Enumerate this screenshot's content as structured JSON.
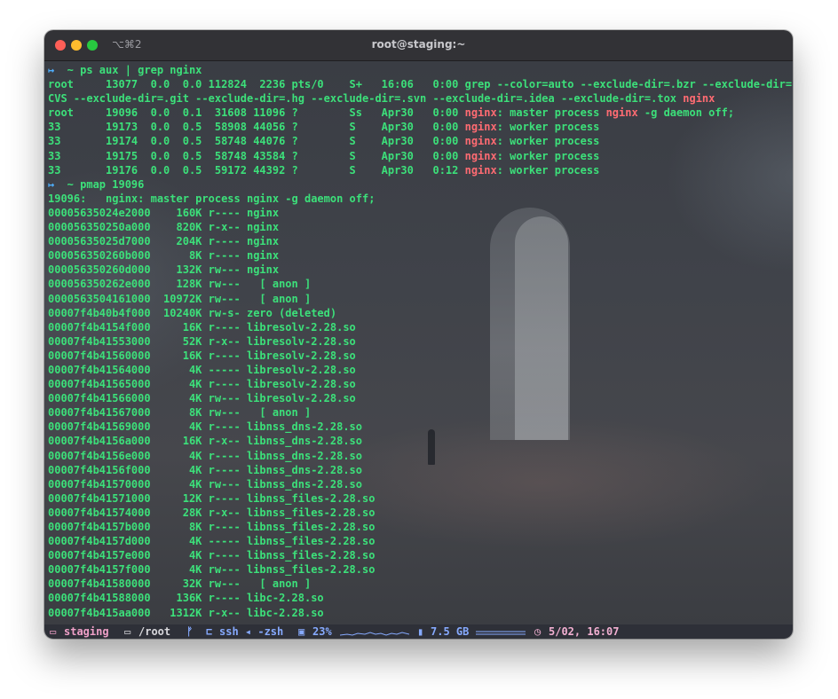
{
  "window": {
    "title": "root@staging:~",
    "tab_shortcut": "⌥⌘2"
  },
  "terminal": {
    "lines": [
      [
        {
          "t": "↦ ",
          "c": "p"
        },
        {
          "t": " ~ ps aux | grep nginx",
          "c": "g"
        }
      ],
      [
        {
          "t": "root     13077  0.0  0.0 112824  2236 pts/0    S+   16:06   0:00 grep --color=auto --exclude-dir=.bzr --exclude-dir=",
          "c": "g"
        }
      ],
      [
        {
          "t": "CVS --exclude-dir=.git --exclude-dir=.hg --exclude-dir=.svn --exclude-dir=.idea --exclude-dir=.tox ",
          "c": "g"
        },
        {
          "t": "nginx",
          "c": "r"
        }
      ],
      [
        {
          "t": "root     19096  0.0  0.1  31608 11096 ?        Ss   Apr30   0:00 ",
          "c": "g"
        },
        {
          "t": "nginx",
          "c": "r"
        },
        {
          "t": ": master process ",
          "c": "g"
        },
        {
          "t": "nginx",
          "c": "r"
        },
        {
          "t": " -g daemon off;",
          "c": "g"
        }
      ],
      [
        {
          "t": "33       19173  0.0  0.5  58908 44056 ?        S    Apr30   0:00 ",
          "c": "g"
        },
        {
          "t": "nginx",
          "c": "r"
        },
        {
          "t": ": worker process",
          "c": "g"
        }
      ],
      [
        {
          "t": "33       19174  0.0  0.5  58748 44076 ?        S    Apr30   0:00 ",
          "c": "g"
        },
        {
          "t": "nginx",
          "c": "r"
        },
        {
          "t": ": worker process",
          "c": "g"
        }
      ],
      [
        {
          "t": "33       19175  0.0  0.5  58748 43584 ?        S    Apr30   0:00 ",
          "c": "g"
        },
        {
          "t": "nginx",
          "c": "r"
        },
        {
          "t": ": worker process",
          "c": "g"
        }
      ],
      [
        {
          "t": "33       19176  0.0  0.5  59172 44392 ?        S    Apr30   0:12 ",
          "c": "g"
        },
        {
          "t": "nginx",
          "c": "r"
        },
        {
          "t": ": worker process",
          "c": "g"
        }
      ],
      [
        {
          "t": "↦ ",
          "c": "p"
        },
        {
          "t": " ~ pmap 19096",
          "c": "g"
        }
      ],
      [
        {
          "t": "19096:   nginx: master process nginx -g daemon off;",
          "c": "g"
        }
      ],
      [
        {
          "t": "00005635024e2000    160K r---- nginx",
          "c": "g"
        }
      ],
      [
        {
          "t": "000056350250a000    820K r-x-- nginx",
          "c": "g"
        }
      ],
      [
        {
          "t": "00005635025d7000    204K r---- nginx",
          "c": "g"
        }
      ],
      [
        {
          "t": "000056350260b000      8K r---- nginx",
          "c": "g"
        }
      ],
      [
        {
          "t": "000056350260d000    132K rw--- nginx",
          "c": "g"
        }
      ],
      [
        {
          "t": "000056350262e000    128K rw---   [ anon ]",
          "c": "g"
        }
      ],
      [
        {
          "t": "0000563504161000  10972K rw---   [ anon ]",
          "c": "g"
        }
      ],
      [
        {
          "t": "00007f4b40b4f000  10240K rw-s- zero (deleted)",
          "c": "g"
        }
      ],
      [
        {
          "t": "00007f4b4154f000     16K r---- libresolv-2.28.so",
          "c": "g"
        }
      ],
      [
        {
          "t": "00007f4b41553000     52K r-x-- libresolv-2.28.so",
          "c": "g"
        }
      ],
      [
        {
          "t": "00007f4b41560000     16K r---- libresolv-2.28.so",
          "c": "g"
        }
      ],
      [
        {
          "t": "00007f4b41564000      4K ----- libresolv-2.28.so",
          "c": "g"
        }
      ],
      [
        {
          "t": "00007f4b41565000      4K r---- libresolv-2.28.so",
          "c": "g"
        }
      ],
      [
        {
          "t": "00007f4b41566000      4K rw--- libresolv-2.28.so",
          "c": "g"
        }
      ],
      [
        {
          "t": "00007f4b41567000      8K rw---   [ anon ]",
          "c": "g"
        }
      ],
      [
        {
          "t": "00007f4b41569000      4K r---- libnss_dns-2.28.so",
          "c": "g"
        }
      ],
      [
        {
          "t": "00007f4b4156a000     16K r-x-- libnss_dns-2.28.so",
          "c": "g"
        }
      ],
      [
        {
          "t": "00007f4b4156e000      4K r---- libnss_dns-2.28.so",
          "c": "g"
        }
      ],
      [
        {
          "t": "00007f4b4156f000      4K r---- libnss_dns-2.28.so",
          "c": "g"
        }
      ],
      [
        {
          "t": "00007f4b41570000      4K rw--- libnss_dns-2.28.so",
          "c": "g"
        }
      ],
      [
        {
          "t": "00007f4b41571000     12K r---- libnss_files-2.28.so",
          "c": "g"
        }
      ],
      [
        {
          "t": "00007f4b41574000     28K r-x-- libnss_files-2.28.so",
          "c": "g"
        }
      ],
      [
        {
          "t": "00007f4b4157b000      8K r---- libnss_files-2.28.so",
          "c": "g"
        }
      ],
      [
        {
          "t": "00007f4b4157d000      4K ----- libnss_files-2.28.so",
          "c": "g"
        }
      ],
      [
        {
          "t": "00007f4b4157e000      4K r---- libnss_files-2.28.so",
          "c": "g"
        }
      ],
      [
        {
          "t": "00007f4b4157f000      4K rw--- libnss_files-2.28.so",
          "c": "g"
        }
      ],
      [
        {
          "t": "00007f4b41580000     32K rw---   [ anon ]",
          "c": "g"
        }
      ],
      [
        {
          "t": "00007f4b41588000    136K r---- libc-2.28.so",
          "c": "g"
        }
      ],
      [
        {
          "t": "00007f4b415aa000   1312K r-x-- libc-2.28.so",
          "c": "g"
        }
      ]
    ]
  },
  "statusbar": {
    "host_icon": "monitor-icon",
    "host": "staging",
    "dir_icon": "folder-icon",
    "dir": "/root",
    "git_icon": "git-branch-icon",
    "tty_icon": "process-tree-icon",
    "session": "ssh ◂ -zsh",
    "cpu_icon": "cpu-icon",
    "cpu": "23%",
    "mem_icon": "memory-icon",
    "mem": "7.5 GB",
    "clock_icon": "clock-icon",
    "datetime": "5/02, 16:07"
  }
}
